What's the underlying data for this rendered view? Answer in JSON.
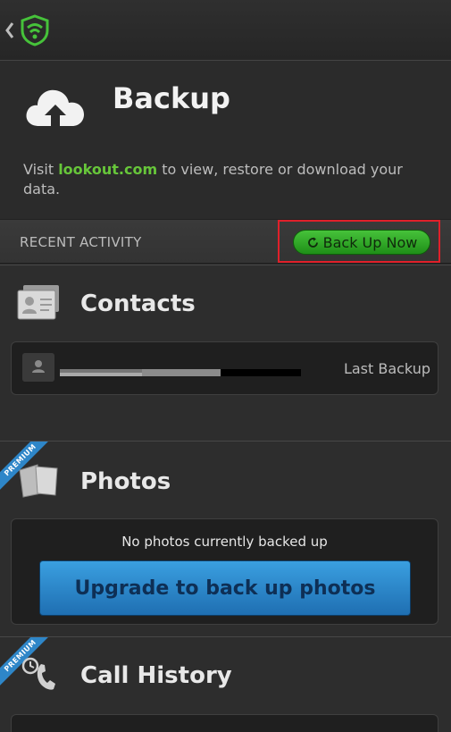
{
  "app": {
    "title": "Backup",
    "description_pre": "Visit ",
    "description_link": "lookout.com",
    "description_post": " to view, restore or download your data."
  },
  "activity": {
    "label": "RECENT ACTIVITY",
    "button_label": "Back Up Now"
  },
  "contacts": {
    "title": "Contacts",
    "last_backup_label": "Last Backup"
  },
  "photos": {
    "badge": "PREMIUM",
    "title": "Photos",
    "empty_text": "No photos currently backed up",
    "upgrade_label": "Upgrade to back up photos"
  },
  "calls": {
    "badge": "PREMIUM",
    "title": "Call History"
  },
  "colors": {
    "accent_green": "#67c63a",
    "button_green": "#2faa26",
    "upgrade_blue": "#2a84c8",
    "highlight_red": "#e0202a"
  }
}
